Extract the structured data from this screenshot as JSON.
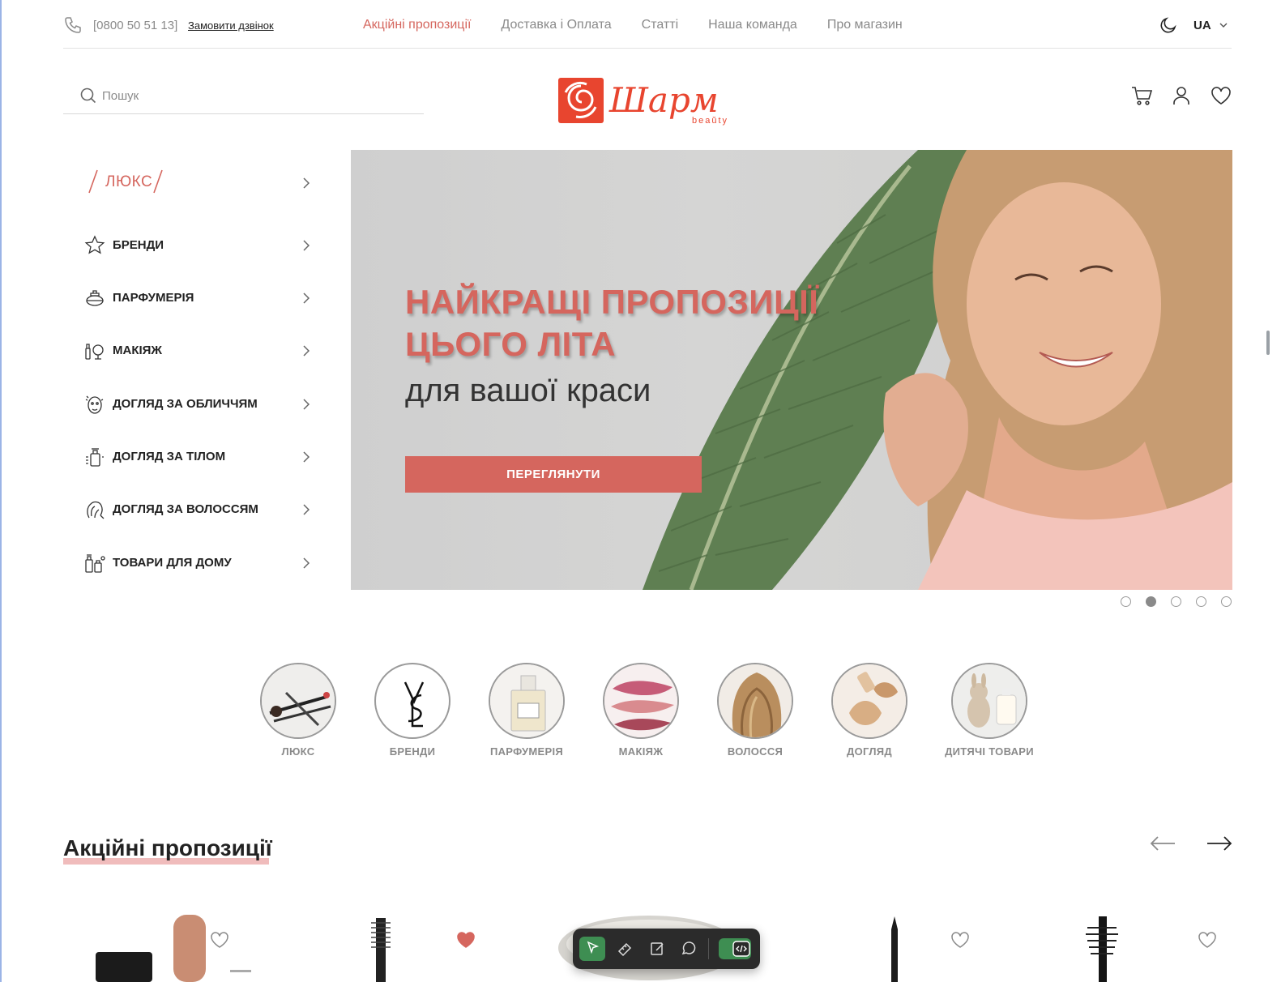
{
  "topbar": {
    "phone": "[0800 50 51 13]",
    "callback": "Замовити дзвінок",
    "nav": [
      "Акційні пропозиції",
      "Доставка і Оплата",
      "Статті",
      "Наша команда",
      "Про магазин"
    ],
    "lang": "UA"
  },
  "header": {
    "search_placeholder": "Пошук",
    "icons": [
      "cart-icon",
      "user-icon",
      "heart-icon"
    ]
  },
  "sidebar": {
    "lux": "ЛЮКС",
    "items": [
      {
        "label": "БРЕНДИ",
        "icon": "star-icon"
      },
      {
        "label": "ПАРФУМЕРІЯ",
        "icon": "perfume-icon"
      },
      {
        "label": "МАКІЯЖ",
        "icon": "makeup-icon"
      },
      {
        "label": "ДОГЛЯД ЗА ОБЛИЧЧЯМ",
        "icon": "face-care-icon"
      },
      {
        "label": "ДОГЛЯД ЗА ТІЛОМ",
        "icon": "body-care-icon"
      },
      {
        "label": "ДОГЛЯД ЗА ВОЛОССЯМ",
        "icon": "hair-care-icon"
      },
      {
        "label": "ТОВАРИ ДЛЯ ДОМУ",
        "icon": "home-goods-icon"
      }
    ]
  },
  "hero": {
    "title_line1": "НАЙКРАЩІ ПРОПОЗИЦІЇ",
    "title_line2": "ЦЬОГО ЛІТА",
    "subtitle": "для вашої краси",
    "button": "ПЕРЕГЛЯНУТИ",
    "slides": 5,
    "active_slide": 2
  },
  "round_categories": [
    "ЛЮКС",
    "БРЕНДИ",
    "ПАРФУМЕРІЯ",
    "МАКІЯЖ",
    "ВОЛОССЯ",
    "ДОГЛЯД",
    "ДИТЯЧІ ТОВАРИ"
  ],
  "promo": {
    "title": "Акційні пропозиції"
  },
  "colors": {
    "accent": "#d5665e",
    "muted": "#8a8a8a",
    "toolbar": "#2b2b2b",
    "toolbar_active": "#3e8e52"
  }
}
